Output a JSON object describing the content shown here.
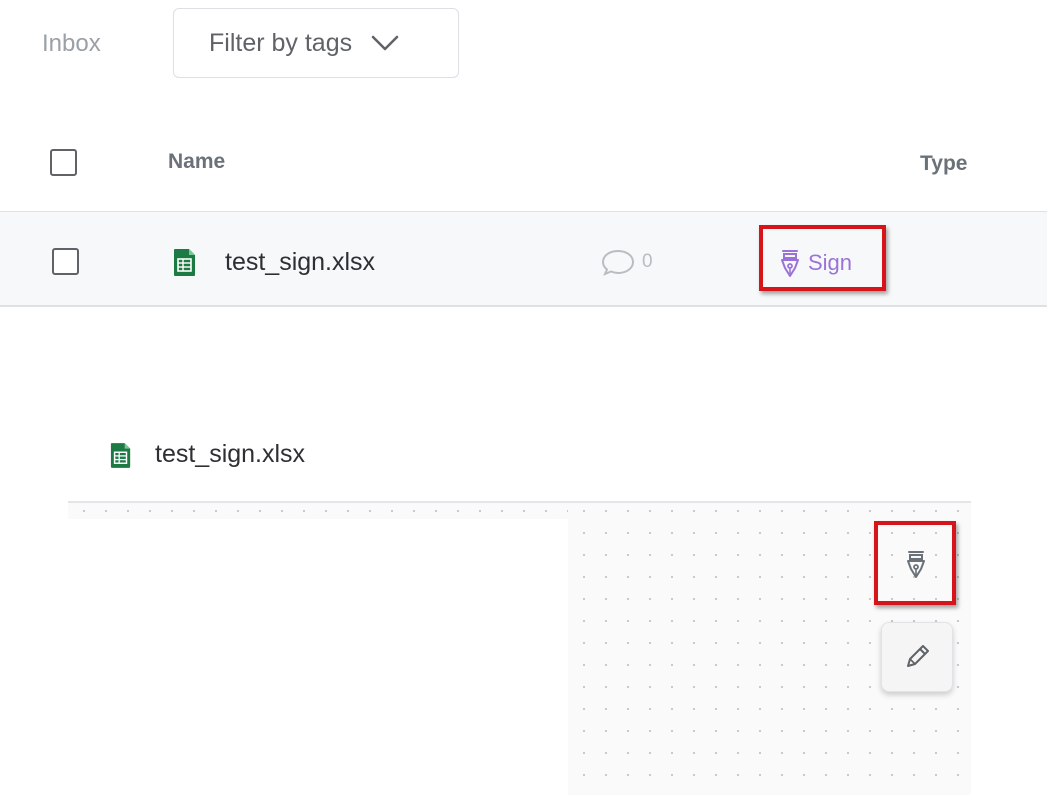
{
  "header": {
    "inbox_label": "Inbox",
    "filter_label": "Filter by tags"
  },
  "table": {
    "columns": {
      "name": "Name",
      "type": "Type"
    },
    "rows": [
      {
        "file_name": "test_sign.xlsx",
        "comment_count": "0",
        "action_label": "Sign"
      }
    ]
  },
  "preview": {
    "file_name": "test_sign.xlsx"
  },
  "colors": {
    "accent_purple": "#9b73d8",
    "highlight_red": "#d7141a",
    "spreadsheet_green": "#1e7a43"
  },
  "icons": {
    "file": "spreadsheet-file-icon",
    "comment": "comment-bubble-icon",
    "sign": "pen-nib-sign-icon",
    "edit": "pencil-icon",
    "dropdown": "chevron-down-icon"
  }
}
